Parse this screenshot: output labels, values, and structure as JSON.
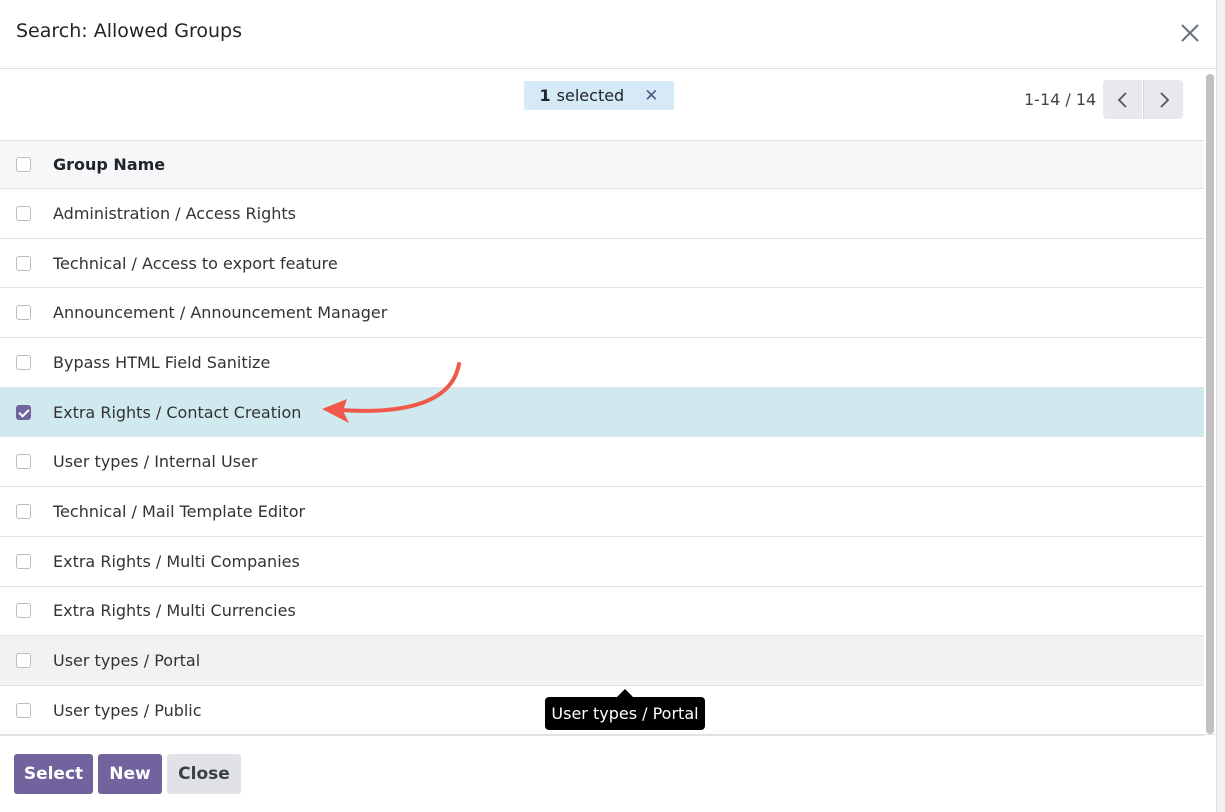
{
  "dialog": {
    "title": "Search: Allowed Groups",
    "close_icon": "close-icon"
  },
  "toolbar": {
    "selected_count": "1",
    "selected_label": "selected",
    "clear_icon": "✕",
    "pager_value": "1-14 / 14",
    "prev_icon": "chevron-left-icon",
    "next_icon": "chevron-right-icon"
  },
  "table": {
    "header": "Group Name",
    "rows": [
      {
        "label": "Administration / Access Rights",
        "checked": false
      },
      {
        "label": "Technical / Access to export feature",
        "checked": false
      },
      {
        "label": "Announcement / Announcement Manager",
        "checked": false
      },
      {
        "label": "Bypass HTML Field Sanitize",
        "checked": false
      },
      {
        "label": "Extra Rights / Contact Creation",
        "checked": true
      },
      {
        "label": "User types / Internal User",
        "checked": false
      },
      {
        "label": "Technical / Mail Template Editor",
        "checked": false
      },
      {
        "label": "Extra Rights / Multi Companies",
        "checked": false
      },
      {
        "label": "Extra Rights / Multi Currencies",
        "checked": false
      },
      {
        "label": "User types / Portal",
        "checked": false
      },
      {
        "label": "User types / Public",
        "checked": false
      }
    ]
  },
  "tooltip": {
    "text": "User types / Portal"
  },
  "footer": {
    "select_label": "Select",
    "new_label": "New",
    "close_label": "Close"
  },
  "colors": {
    "primary": "#71639e",
    "selected_row": "#d0e9ef",
    "badge": "#d5e9f7",
    "annotation_arrow": "#f0594a"
  }
}
